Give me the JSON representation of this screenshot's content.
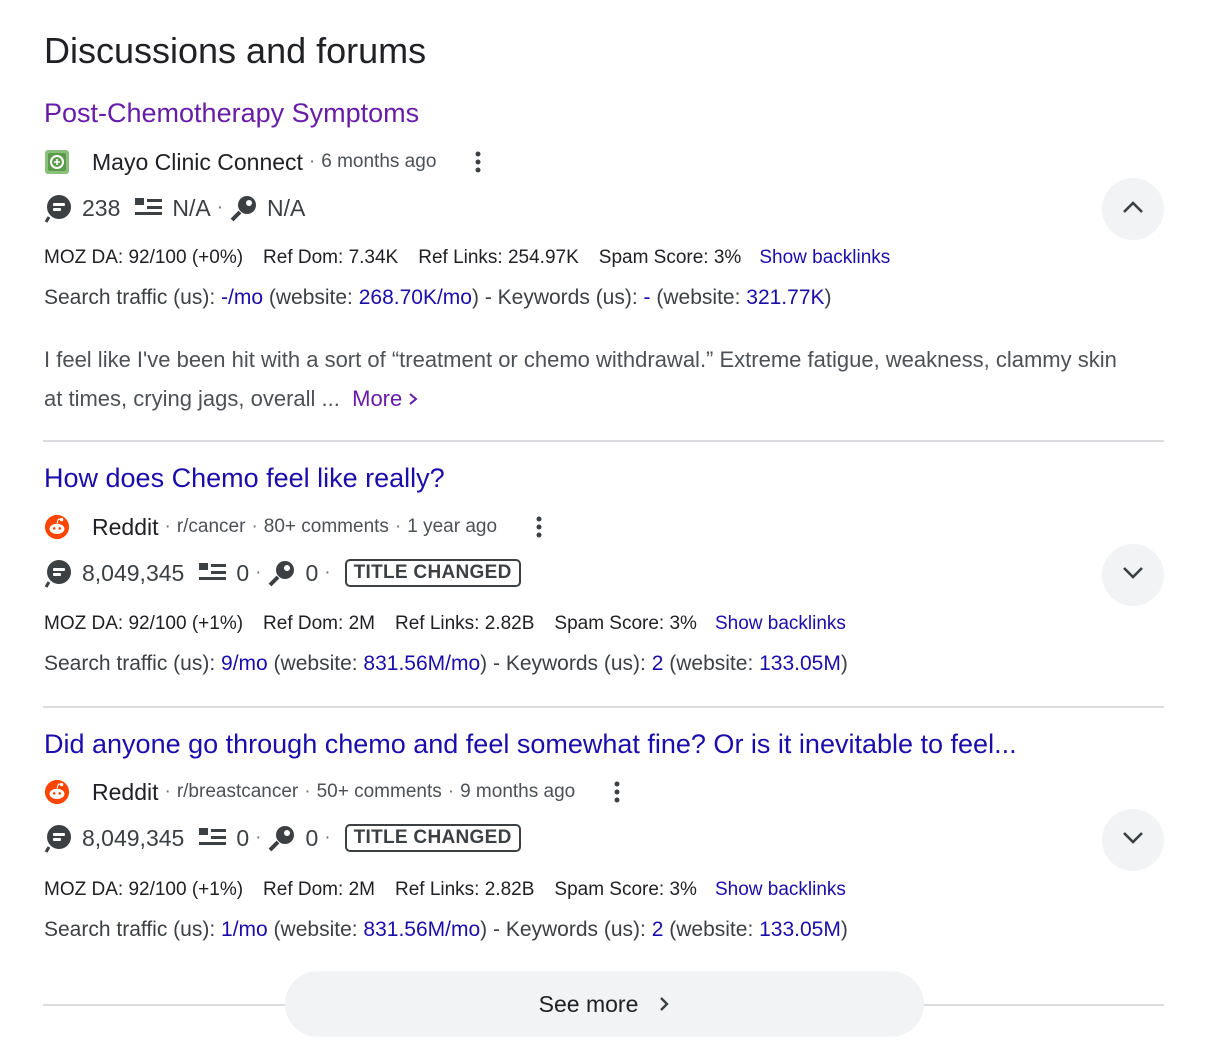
{
  "heading": "Discussions and forums",
  "results": [
    {
      "title": "Post-Chemotherapy Symptoms",
      "source": "Mayo Clinic Connect",
      "meta": [
        "6 months ago"
      ],
      "favicon": "mayo-clinic-icon",
      "comments": "238",
      "list_stat": "N/A",
      "key_stat": "N/A",
      "moz": [
        "MOZ DA: 92/100 (+0%)",
        "Ref Dom: 7.34K",
        "Ref Links: 254.97K",
        "Spam Score: 3%"
      ],
      "backlinks": "Show backlinks",
      "traffic": {
        "label": "Search traffic (us):",
        "value": "-/mo",
        "website_label": "(website:",
        "website_value": "268.70K/mo",
        "close": ")",
        "kw_label": "- Keywords (us):",
        "kw_value": "-",
        "kw_website_label": "(website:",
        "kw_website_value": "321.77K",
        "kw_close": ")"
      },
      "snippet": "I feel like I've been hit with a sort of “treatment or chemo withdrawal.” Extreme fatigue, weakness, clammy skin at times, crying jags, overall ...",
      "more": "More",
      "expanded": true
    },
    {
      "title": "How does Chemo feel like really?",
      "source": "Reddit",
      "meta": [
        "r/cancer",
        "80+ comments",
        "1 year ago"
      ],
      "favicon": "reddit-icon",
      "comments": "8,049,345",
      "list_stat": "0",
      "key_stat": "0",
      "badge": "TITLE CHANGED",
      "moz": [
        "MOZ DA: 92/100 (+1%)",
        "Ref Dom: 2M",
        "Ref Links: 2.82B",
        "Spam Score: 3%"
      ],
      "backlinks": "Show backlinks",
      "traffic": {
        "label": "Search traffic (us):",
        "value": "9/mo",
        "website_label": "(website:",
        "website_value": "831.56M/mo",
        "close": ")",
        "kw_label": "- Keywords (us):",
        "kw_value": "2",
        "kw_website_label": "(website:",
        "kw_website_value": "133.05M",
        "kw_close": ")"
      },
      "expanded": false
    },
    {
      "title": "Did anyone go through chemo and feel somewhat fine? Or is it inevitable to feel...",
      "source": "Reddit",
      "meta": [
        "r/breastcancer",
        "50+ comments",
        "9 months ago"
      ],
      "favicon": "reddit-icon",
      "comments": "8,049,345",
      "list_stat": "0",
      "key_stat": "0",
      "badge": "TITLE CHANGED",
      "moz": [
        "MOZ DA: 92/100 (+1%)",
        "Ref Dom: 2M",
        "Ref Links: 2.82B",
        "Spam Score: 3%"
      ],
      "backlinks": "Show backlinks",
      "traffic": {
        "label": "Search traffic (us):",
        "value": "1/mo",
        "website_label": "(website:",
        "website_value": "831.56M/mo",
        "close": ")",
        "kw_label": "- Keywords (us):",
        "kw_value": "2",
        "kw_website_label": "(website:",
        "kw_website_value": "133.05M",
        "kw_close": ")"
      },
      "expanded": false
    }
  ],
  "see_more": "See more",
  "colors": {
    "link": "#1a0dab",
    "visited": "#681da8",
    "reddit": "#ff4500",
    "mayo": "#6aa84f"
  }
}
